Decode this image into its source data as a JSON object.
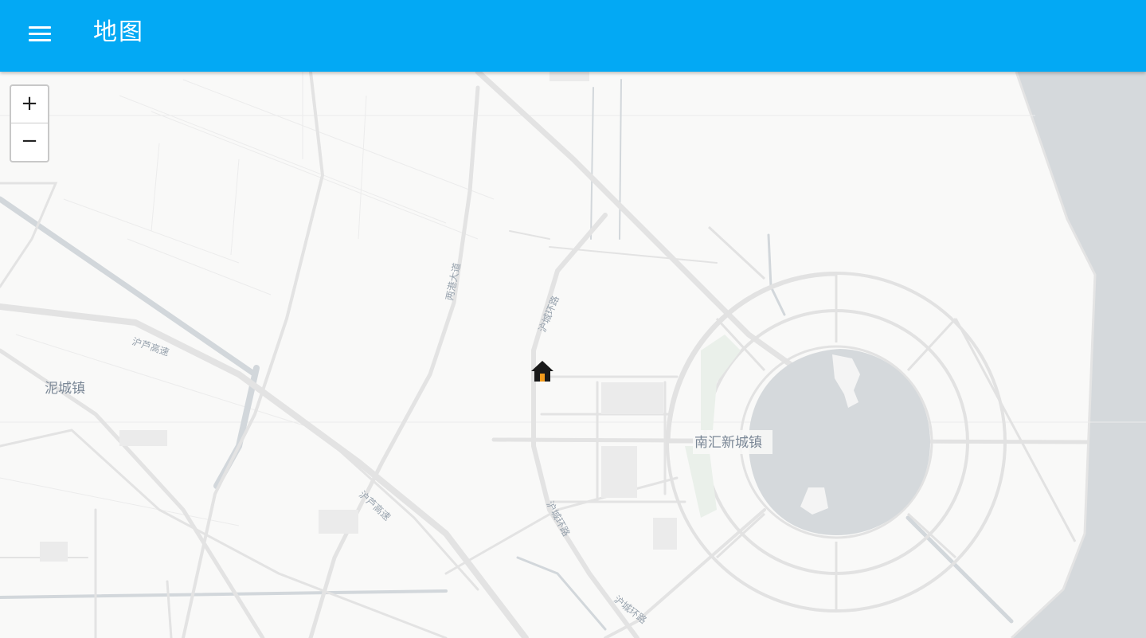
{
  "header": {
    "title": "地图",
    "menu_icon": "hamburger-menu-icon"
  },
  "map": {
    "zoom_in_label": "+",
    "zoom_out_label": "−",
    "labels": {
      "town_nicheng": "泥城镇",
      "town_nanhui": "南汇新城镇",
      "road_huluhigh_1": "沪芦高速",
      "road_huluhigh_2": "沪芦高速",
      "road_lianggang": "两港大道",
      "road_huchenghuan_1": "沪城环路",
      "road_huchenghuan_2": "沪城环路",
      "road_huchenghuan_3": "沪城环路"
    },
    "marker_icon": "home-marker-icon",
    "colors": {
      "appbar": "#03a9f4",
      "land": "#f9f9f8",
      "water": "#d5d9dc",
      "road": "#e6e6e6"
    }
  }
}
